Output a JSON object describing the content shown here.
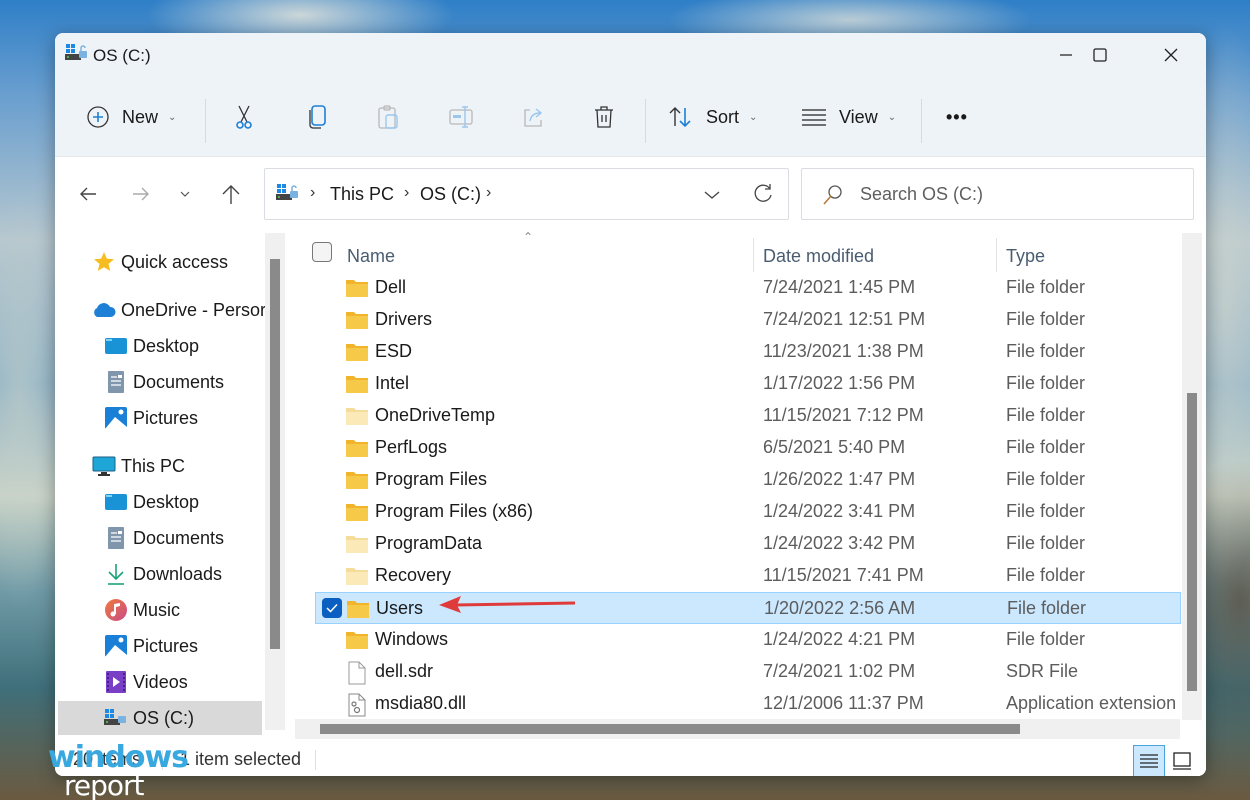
{
  "window": {
    "title": "OS (C:)",
    "controls": {
      "minimize": "minimize",
      "maximize": "maximize",
      "close": "close"
    }
  },
  "toolbar": {
    "new_label": "New",
    "sort_label": "Sort",
    "view_label": "View",
    "more_label": "•••",
    "icons": [
      "plus-circle-icon",
      "cut-icon",
      "copy-icon",
      "paste-icon",
      "rename-icon",
      "share-icon",
      "delete-icon",
      "sort-icon",
      "view-icon",
      "more-icon"
    ]
  },
  "navigation": {
    "breadcrumb": [
      "This PC",
      "OS (C:)"
    ],
    "search_placeholder": "Search OS (C:)"
  },
  "sidebar": {
    "items": [
      {
        "label": "Quick access",
        "icon": "star-icon",
        "level": 0
      },
      {
        "label": "OneDrive - Persor",
        "icon": "cloud-icon",
        "level": 0
      },
      {
        "label": "Desktop",
        "icon": "desktop-icon",
        "level": 1
      },
      {
        "label": "Documents",
        "icon": "documents-icon",
        "level": 1
      },
      {
        "label": "Pictures",
        "icon": "pictures-icon",
        "level": 1
      },
      {
        "label": "This PC",
        "icon": "monitor-icon",
        "level": 0
      },
      {
        "label": "Desktop",
        "icon": "desktop-icon",
        "level": 1
      },
      {
        "label": "Documents",
        "icon": "documents-icon",
        "level": 1
      },
      {
        "label": "Downloads",
        "icon": "download-icon",
        "level": 1
      },
      {
        "label": "Music",
        "icon": "music-icon",
        "level": 1
      },
      {
        "label": "Pictures",
        "icon": "pictures-icon",
        "level": 1
      },
      {
        "label": "Videos",
        "icon": "videos-icon",
        "level": 1
      },
      {
        "label": "OS (C:)",
        "icon": "drive-icon",
        "level": 1,
        "selected": true
      }
    ]
  },
  "file_list": {
    "columns": {
      "name": "Name",
      "date": "Date modified",
      "type": "Type"
    },
    "rows": [
      {
        "name": "Dell",
        "date": "7/24/2021 1:45 PM",
        "type": "File folder",
        "icon": "folder"
      },
      {
        "name": "Drivers",
        "date": "7/24/2021 12:51 PM",
        "type": "File folder",
        "icon": "folder"
      },
      {
        "name": "ESD",
        "date": "11/23/2021 1:38 PM",
        "type": "File folder",
        "icon": "folder"
      },
      {
        "name": "Intel",
        "date": "1/17/2022 1:56 PM",
        "type": "File folder",
        "icon": "folder"
      },
      {
        "name": "OneDriveTemp",
        "date": "11/15/2021 7:12 PM",
        "type": "File folder",
        "icon": "folder-hidden"
      },
      {
        "name": "PerfLogs",
        "date": "6/5/2021 5:40 PM",
        "type": "File folder",
        "icon": "folder"
      },
      {
        "name": "Program Files",
        "date": "1/26/2022 1:47 PM",
        "type": "File folder",
        "icon": "folder"
      },
      {
        "name": "Program Files (x86)",
        "date": "1/24/2022 3:41 PM",
        "type": "File folder",
        "icon": "folder"
      },
      {
        "name": "ProgramData",
        "date": "1/24/2022 3:42 PM",
        "type": "File folder",
        "icon": "folder-hidden"
      },
      {
        "name": "Recovery",
        "date": "11/15/2021 7:41 PM",
        "type": "File folder",
        "icon": "folder-hidden"
      },
      {
        "name": "Users",
        "date": "1/20/2022 2:56 AM",
        "type": "File folder",
        "icon": "folder",
        "selected": true
      },
      {
        "name": "Windows",
        "date": "1/24/2022 4:21 PM",
        "type": "File folder",
        "icon": "folder"
      },
      {
        "name": "dell.sdr",
        "date": "7/24/2021 1:02 PM",
        "type": "SDR File",
        "icon": "file"
      },
      {
        "name": "msdia80.dll",
        "date": "12/1/2006 11:37 PM",
        "type": "Application extension",
        "icon": "dll"
      }
    ]
  },
  "status": {
    "item_count": "20 items",
    "selection": "1 item selected"
  },
  "colors": {
    "accent": "#0a5fc0",
    "selection_bg": "#cce8ff",
    "selection_border": "#99d1ff",
    "annotation_arrow": "#e03b3b",
    "folder": "#f5c142"
  },
  "watermark": {
    "line1": "windows",
    "line2": "report"
  }
}
